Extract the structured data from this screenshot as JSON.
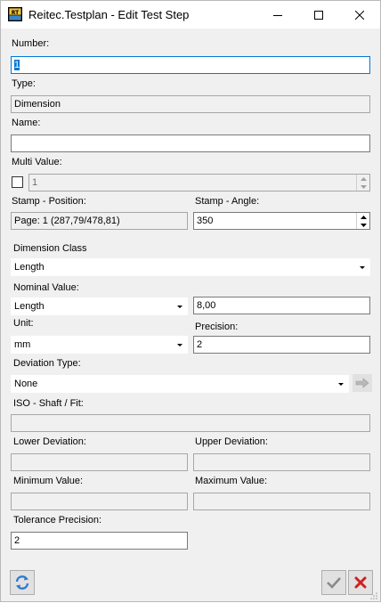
{
  "window": {
    "title": "Reitec.Testplan - Edit Test Step"
  },
  "form": {
    "number": {
      "label": "Number:",
      "value": "1"
    },
    "type": {
      "label": "Type:",
      "value": "Dimension"
    },
    "name": {
      "label": "Name:",
      "value": ""
    },
    "multi_value": {
      "label": "Multi Value:",
      "checked": false,
      "value": "1"
    },
    "stamp_position": {
      "label": "Stamp - Position:",
      "value": "Page: 1 (287,79/478,81)"
    },
    "stamp_angle": {
      "label": "Stamp - Angle:",
      "value": "350"
    },
    "dimension_class": {
      "label": "Dimension Class",
      "value": "Length"
    },
    "nominal_value": {
      "label": "Nominal Value:",
      "type_value": "Length",
      "value": "8,00"
    },
    "unit": {
      "label": "Unit:",
      "value": "mm"
    },
    "precision": {
      "label": "Precision:",
      "value": "2"
    },
    "deviation_type": {
      "label": "Deviation Type:",
      "value": "None"
    },
    "iso_shaft_fit": {
      "label": "ISO - Shaft / Fit:",
      "value": ""
    },
    "lower_deviation": {
      "label": "Lower Deviation:",
      "value": ""
    },
    "upper_deviation": {
      "label": "Upper Deviation:",
      "value": ""
    },
    "minimum_value": {
      "label": "Minimum Value:",
      "value": ""
    },
    "maximum_value": {
      "label": "Maximum Value:",
      "value": ""
    },
    "tolerance_precision": {
      "label": "Tolerance Precision:",
      "value": "2"
    }
  },
  "icons": {
    "app": "app-logo-icon",
    "refresh": "refresh-icon",
    "ok": "checkmark-icon",
    "cancel": "close-x-icon",
    "arrow_right": "arrow-right-icon"
  },
  "colors": {
    "focus": "#0078d7",
    "cancel_red": "#d21f1f",
    "refresh_blue": "#2a7ad5"
  }
}
